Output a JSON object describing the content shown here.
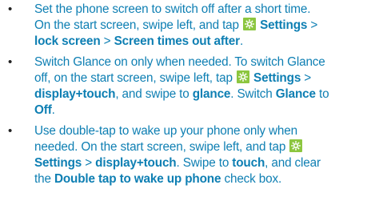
{
  "bullet_symbol": "•",
  "icons": {
    "settings": "settings-gear-icon"
  },
  "colors": {
    "text": "#0e7fb3",
    "icon_bg": "#8cc63f",
    "bullet": "#222222"
  },
  "items": [
    {
      "line1": "Set the phone screen to switch off after a short time.",
      "line2_a": "On the start screen, swipe left, and tap",
      "settings": "Settings",
      "sep1": ">",
      "lock_screen": "lock screen",
      "sep2": ">",
      "screen_timeout": "Screen times out after",
      "end": "."
    },
    {
      "line1": "Switch Glance on only when needed. To switch Glance",
      "line2_a": "off, on the start screen, swipe left, tap",
      "settings": "Settings",
      "sep1": ">",
      "display_touch": "display+touch",
      "mid": ", and swipe to",
      "glance": "glance",
      "mid2": ". Switch",
      "glance_cap": "Glance",
      "to": "to",
      "off": "Off",
      "end": "."
    },
    {
      "line1": "Use double-tap to wake up your phone only when",
      "line2": "needed. On the start screen, swipe left, and tap",
      "settings": "Settings",
      "sep1": ">",
      "display_touch": "display+touch",
      "mid": ". Swipe to",
      "touch": "touch",
      "mid2": ", and clear",
      "line4_a": "the",
      "double_tap": "Double tap to wake up phone",
      "check_box": "check box."
    }
  ]
}
